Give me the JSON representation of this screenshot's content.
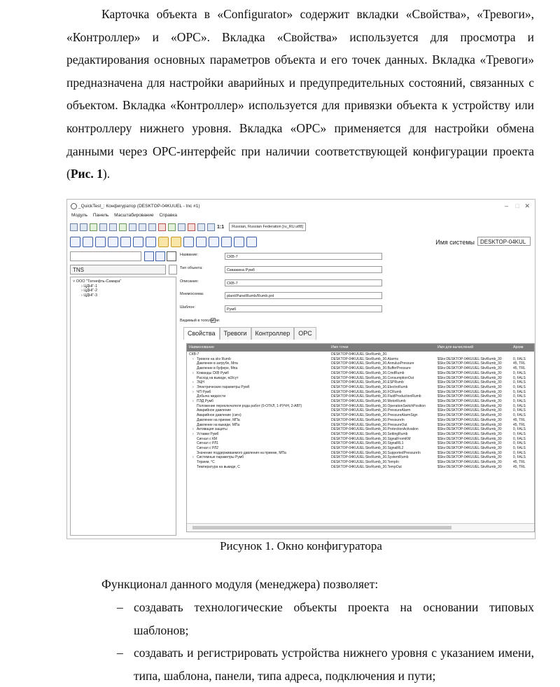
{
  "intro_paragraph": "Карточка объекта в «Configurator» содержит вкладки «Свойства», «Тревоги», «Контроллер» и «OPC». Вкладка «Свойства» используется для просмотра и редактирования основных параметров объекта и его точек данных. Вкладка «Тревоги» предназначена для настройки аварийных и предупредительных состояний, связанных с объектом. Вкладка «Контроллер» используется для привязки объекта к устройству или контроллеру нижнего уровня. Вкладка «OPC» применяется для настройки обмена данными через OPC-интерфейс при наличии соответствующей конфигурации проекта (",
  "intro_ref": "Рис. 1",
  "intro_end": ").",
  "caption": "Рисунок 1. Окно конфигуратора",
  "functional_intro": "Функционал данного модуля (менеджера) позволяет:",
  "list": [
    "создавать технологические объекты проекта на основании типовых шаблонов;",
    "создавать и регистрировать устройства нижнего уровня с указанием имени, типа, шаблона, панели, типа адреса, подключения и пути;"
  ],
  "list_dash": "–",
  "window": {
    "title": "_QuickTest_: Конфигуратор (DESKTOP-04KUUEL - tnc #1)",
    "menu": [
      "Модуль",
      "Панель",
      "Масштабирование",
      "Справка"
    ],
    "zoom": "1:1",
    "locale": "Russian, Russian Federation [ru_RU.utf8]",
    "system_label": "Имя системы",
    "system_value": "DESKTOP-04KUL",
    "tns": "TNS",
    "tree": [
      "ООО \"Татнефть-Самара\"",
      "ЦДНГ-1",
      "ЦДНГ-2",
      "ЦДНГ-3"
    ],
    "props": [
      {
        "label": "Название:",
        "value": "СКВ-7"
      },
      {
        "label": "Тип объекта:",
        "value": "Скважина Румб"
      },
      {
        "label": "Описание:",
        "value": "СКВ-7"
      },
      {
        "label": "Мнемосхема:",
        "value": "plant/PanelRumb/Rumb.pnl"
      },
      {
        "label": "Шаблон:",
        "value": "Румб"
      }
    ],
    "visible_label": "Видимый в топологии:",
    "tabs": [
      "Свойства",
      "Тревоги",
      "Контроллер",
      "OPC"
    ],
    "grid_headers": [
      "Наименование",
      "Имя точки",
      "Имя для вычислений",
      "Архив"
    ],
    "grid_rows": [
      {
        "name": "СКВ-7",
        "point": "DESKTOP-04KUUEL:SkvRumb_30.",
        "calc": "",
        "arch": ""
      },
      {
        "name": "Тревоги на skv Rumb",
        "point": "DESKTOP-04KUUEL:SkvRumb_30.Alarms",
        "calc": "$Skv:DESKTOP-04KUUEL:SkvRumb_30",
        "arch": "0, FALS"
      },
      {
        "name": "Давление в затрубе, Мпа",
        "point": "DESKTOP-04KUUEL:SkvRumb_30.AnnulusPressure",
        "calc": "$Skv:DESKTOP-04KUUEL:SkvRumb_30",
        "arch": "45, TRL"
      },
      {
        "name": "Давление в буфере, Мпа",
        "point": "DESKTOP-04KUUEL:SkvRumb_30.BufferPressure",
        "calc": "$Skv:DESKTOP-04KUUEL:SkvRumb_30",
        "arch": "45, TRL"
      },
      {
        "name": "Команды СКВ Румб",
        "point": "DESKTOP-04KUUEL:SkvRumb_30.CmdRumb",
        "calc": "$Skv:DESKTOP-04KUUEL:SkvRumb_30",
        "arch": "0, FALS"
      },
      {
        "name": "Расход на выкиде, м3/сут",
        "point": "DESKTOP-04KUUEL:SkvRumb_30.ConsumptionOut",
        "calc": "$Skv:DESKTOP-04KUUEL:SkvRumb_30",
        "arch": "0, FALS"
      },
      {
        "name": "ЭЦН",
        "point": "DESKTOP-04KUUEL:SkvRumb_30.ESPRumb",
        "calc": "$Skv:DESKTOP-04KUUEL:SkvRumb_30",
        "arch": "0, FALS"
      },
      {
        "name": "Электрические параметры Румб",
        "point": "DESKTOP-04KUUEL:SkvRumb_30.ElectroRumb",
        "calc": "$Skv:DESKTOP-04KUUEL:SkvRumb_30",
        "arch": "0, FALS"
      },
      {
        "name": "ЧП Румб",
        "point": "DESKTOP-04KUUEL:SkvRumb_30.FCRumb",
        "calc": "$Skv:DESKTOP-04KUUEL:SkvRumb_30",
        "arch": "0, FALS"
      },
      {
        "name": "Добыча жидкости",
        "point": "DESKTOP-04KUUEL:SkvRumb_30.FluidProductionRumb",
        "calc": "$Skv:DESKTOP-04KUUEL:SkvRumb_30",
        "arch": "0, FALS"
      },
      {
        "name": "ПЭД Румб",
        "point": "DESKTOP-04KUUEL:SkvRumb_30.MotorRumb",
        "calc": "$Skv:DESKTOP-04KUUEL:SkvRumb_30",
        "arch": "0, FALS"
      },
      {
        "name": "Положение переключателя рода работ (0-ОТКЛ, 1-РУЧН, 2-АВТ)",
        "point": "DESKTOP-04KUUEL:SkvRumb_30.OperationSwitchPosition",
        "calc": "$Skv:DESKTOP-04KUUEL:SkvRumb_30",
        "arch": "0, FALS"
      },
      {
        "name": "Аварийное давление",
        "point": "DESKTOP-04KUUEL:SkvRumb_30.PressureAlarm",
        "calc": "$Skv:DESKTOP-04KUUEL:SkvRumb_30",
        "arch": "0, FALS"
      },
      {
        "name": "Аварийное давление (сигн)",
        "point": "DESKTOP-04KUUEL:SkvRumb_30.PressureAlarmSign",
        "calc": "$Skv:DESKTOP-04KUUEL:SkvRumb_30",
        "arch": "0, FALS"
      },
      {
        "name": "Давление на приеме, МПа",
        "point": "DESKTOP-04KUUEL:SkvRumb_30.PressureIn",
        "calc": "$Skv:DESKTOP-04KUUEL:SkvRumb_30",
        "arch": "45, TRL"
      },
      {
        "name": "Давление на выкиде, МПа",
        "point": "DESKTOP-04KUUEL:SkvRumb_30.PressureOut",
        "calc": "$Skv:DESKTOP-04KUUEL:SkvRumb_30",
        "arch": "45, TRL"
      },
      {
        "name": "Активация защиты",
        "point": "DESKTOP-04KUUEL:SkvRumb_30.ProtectionActivation",
        "calc": "$Skv:DESKTOP-04KUUEL:SkvRumb_30",
        "arch": "0, FALS"
      },
      {
        "name": "Уставки Румб",
        "point": "DESKTOP-04KUUEL:SkvRumb_30.SettingRumb",
        "calc": "$Skv:DESKTOP-04KUUEL:SkvRumb_30",
        "arch": "0, FALS"
      },
      {
        "name": "Сигнал с КМ",
        "point": "DESKTOP-04KUUEL:SkvRumb_30.SignalFromKM",
        "calc": "$Skv:DESKTOP-04KUUEL:SkvRumb_30",
        "arch": "0, FALS"
      },
      {
        "name": "Сигнал с РЛ1",
        "point": "DESKTOP-04KUUEL:SkvRumb_30.SignalRL1",
        "calc": "$Skv:DESKTOP-04KUUEL:SkvRumb_30",
        "arch": "0, FALS"
      },
      {
        "name": "Сигнал с РЛ2",
        "point": "DESKTOP-04KUUEL:SkvRumb_30.SignalRL2",
        "calc": "$Skv:DESKTOP-04KUUEL:SkvRumb_30",
        "arch": "0, FALS"
      },
      {
        "name": "Значение поддерживаемого давления на приеме, МПа",
        "point": "DESKTOP-04KUUEL:SkvRumb_30.SupportedPressureIn",
        "calc": "$Skv:DESKTOP-04KUUEL:SkvRumb_30",
        "arch": "0, FALS"
      },
      {
        "name": "Системные параметры Румб",
        "point": "DESKTOP-04KUUEL:SkvRumb_30.SystemRumb",
        "calc": "$Skv:DESKTOP-04KUUEL:SkvRumb_30",
        "arch": "0, FALS"
      },
      {
        "name": "Тприем, °С",
        "point": "DESKTOP-04KUUEL:SkvRumb_30.TempIn",
        "calc": "$Skv:DESKTOP-04KUUEL:SkvRumb_30",
        "arch": "45, TRL"
      },
      {
        "name": "Температура на выкиде, С",
        "point": "DESKTOP-04KUUEL:SkvRumb_30.TempOut",
        "calc": "$Skv:DESKTOP-04KUUEL:SkvRumb_30",
        "arch": "45, TRL"
      }
    ]
  }
}
